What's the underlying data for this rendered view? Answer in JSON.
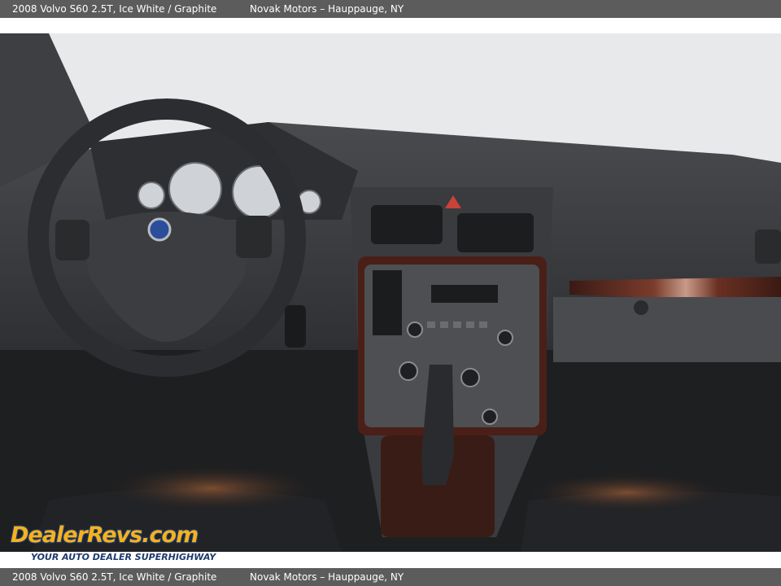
{
  "header": {
    "title": "2008 Volvo S60 2.5T,  Ice White / Graphite",
    "dealer": "Novak Motors – Hauppauge, NY"
  },
  "footer": {
    "title": "2008 Volvo S60 2.5T,  Ice White / Graphite",
    "dealer": "Novak Motors – Hauppauge, NY"
  },
  "watermark": {
    "brand": "DealerRevs.com",
    "tagline": "YOUR AUTO DEALER SUPERHIGHWAY"
  },
  "photo": {
    "subject": "car-interior-dashboard",
    "colors": {
      "interior": "#3a3b3e",
      "wood_trim": "#5a2a20",
      "ambient": "#c46a3a"
    }
  }
}
